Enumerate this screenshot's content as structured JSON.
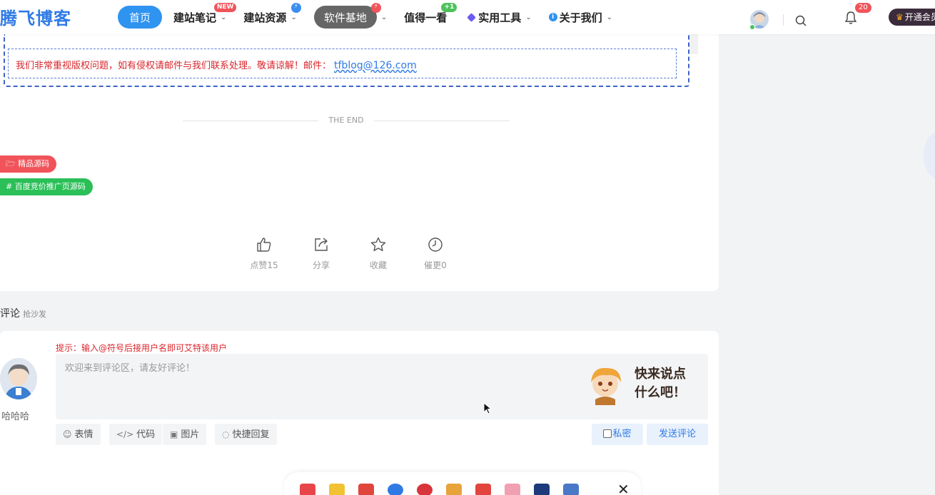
{
  "header": {
    "logo": "腾飞博客",
    "nav": [
      {
        "label": "首页"
      },
      {
        "label": "建站笔记",
        "badge": "NEW"
      },
      {
        "label": "建站资源",
        "badge": "⚡"
      },
      {
        "label": "软件基地",
        "badge": "⚡"
      },
      {
        "label": "值得一看",
        "badge": "+1"
      },
      {
        "label": "实用工具"
      },
      {
        "label": "关于我们"
      }
    ],
    "bell_count": "20",
    "vip_label": "开通会员"
  },
  "article": {
    "notice": "我们非常重视版权问题，如有侵权请邮件与我们联系处理。敬请谅解！邮件：",
    "notice_email": "tfblog@126.com",
    "the_end": "THE END",
    "tags": [
      "精品源码",
      "百度竞价推广页源码"
    ],
    "actions": [
      {
        "icon": "thumbs-up-icon",
        "label": "点赞15"
      },
      {
        "icon": "share-icon",
        "label": "分享"
      },
      {
        "icon": "star-icon",
        "label": "收藏"
      },
      {
        "icon": "clock-icon",
        "label": "催更0"
      }
    ]
  },
  "comments": {
    "heading": "评论",
    "sub": "抢沙发",
    "hint": "提示：输入@符号后接用户名即可艾特该用户",
    "placeholder": "欢迎来到评论区，请友好评论！",
    "user_name": "哈哈哈",
    "sticker_text_line1": "快来说点",
    "sticker_text_line2": "什么吧！",
    "tools": [
      "表情",
      "代码",
      "图片",
      "快捷回复"
    ],
    "private_label": "私密",
    "send_label": "发送评论"
  },
  "colors": {
    "primary": "#2f93f0",
    "danger": "#d9262c",
    "tag_red": "#f0545a",
    "tag_green": "#2bbf58"
  }
}
